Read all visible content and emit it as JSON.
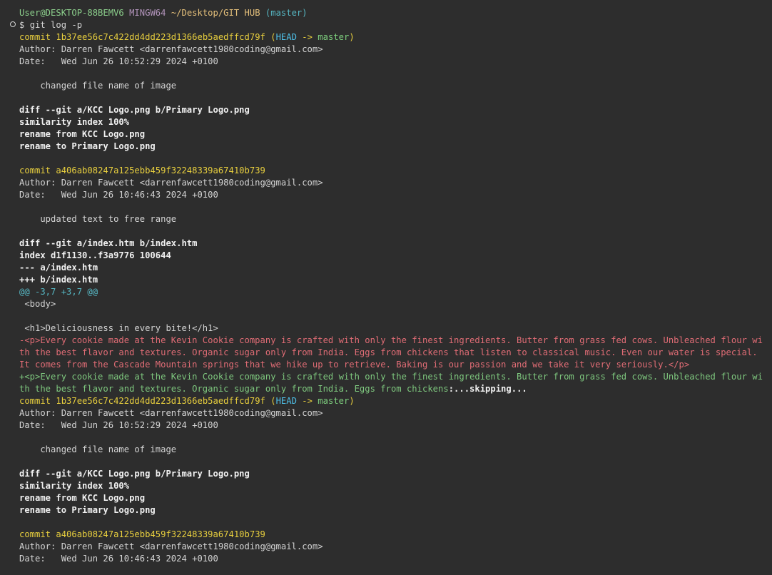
{
  "prompt": {
    "user_host": "User@DESKTOP-88BEMV6",
    "shell": "MINGW64",
    "path": "~/Desktop/GIT HUB",
    "branch": "(master)",
    "symbol": "$",
    "command": "git log -p"
  },
  "blocks": [
    {
      "commit_label": "commit",
      "hash": "1b37ee56c7c422dd4dd223d1366eb5aedffcd79f",
      "refs_open": "(",
      "head": "HEAD",
      "arrow": " -> ",
      "branch": "master",
      "refs_close": ")",
      "author": "Author: Darren Fawcett <darrenfawcett1980coding@gmail.com>",
      "date": "Date:   Wed Jun 26 10:52:29 2024 +0100",
      "message": "    changed file name of image",
      "diff": [
        "diff --git a/KCC Logo.png b/Primary Logo.png",
        "similarity index 100%",
        "rename from KCC Logo.png",
        "rename to Primary Logo.png"
      ]
    },
    {
      "commit_label": "commit",
      "hash": "a406ab08247a125ebb459f32248339a67410b739",
      "author": "Author: Darren Fawcett <darrenfawcett1980coding@gmail.com>",
      "date": "Date:   Wed Jun 26 10:46:43 2024 +0100",
      "message": "    updated text to free range",
      "diff": [
        "diff --git a/index.htm b/index.htm",
        "index d1f1130..f3a9776 100644",
        "--- a/index.htm",
        "+++ b/index.htm"
      ],
      "hunk": "@@ -3,7 +3,7 @@",
      "context": [
        " <body>",
        "",
        " <h1>Deliciousness in every bite!</h1>"
      ],
      "removed": "-<p>Every cookie made at the Kevin Cookie company is crafted with only the finest ingredients. Butter from grass fed cows. Unbleached flour with the best flavor and textures. Organic sugar only from India. Eggs from chickens that listen to classical music. Even our water is special. It comes from the Cascade Mountain springs that we hike up to retrieve. Baking is our passion and we take it very seriously.</p>",
      "added": "+<p>Every cookie made at the Kevin Cookie company is crafted with only the finest ingredients. Butter from grass fed cows. Unbleached flour with the best flavor and textures. Organic sugar only from India. Eggs from chickens",
      "skipping": ":...skipping..."
    },
    {
      "commit_label": "commit",
      "hash": "1b37ee56c7c422dd4dd223d1366eb5aedffcd79f",
      "refs_open": "(",
      "head": "HEAD",
      "arrow": " -> ",
      "branch": "master",
      "refs_close": ")",
      "author": "Author: Darren Fawcett <darrenfawcett1980coding@gmail.com>",
      "date": "Date:   Wed Jun 26 10:52:29 2024 +0100",
      "message": "    changed file name of image",
      "diff": [
        "diff --git a/KCC Logo.png b/Primary Logo.png",
        "similarity index 100%",
        "rename from KCC Logo.png",
        "rename to Primary Logo.png"
      ]
    },
    {
      "commit_label": "commit",
      "hash": "a406ab08247a125ebb459f32248339a67410b739",
      "author": "Author: Darren Fawcett <darrenfawcett1980coding@gmail.com>",
      "date": "Date:   Wed Jun 26 10:46:43 2024 +0100"
    }
  ],
  "colors": {
    "background": "#2d2d2d",
    "text": "#d4d4d4",
    "commit": "#e8cf3e",
    "head": "#4fc1e9",
    "branch": "#7ed07e",
    "removed": "#e06c75",
    "added": "#7ec77e",
    "hunk": "#56b6c2"
  },
  "icons": {
    "gutter": "circle-marker-icon"
  }
}
